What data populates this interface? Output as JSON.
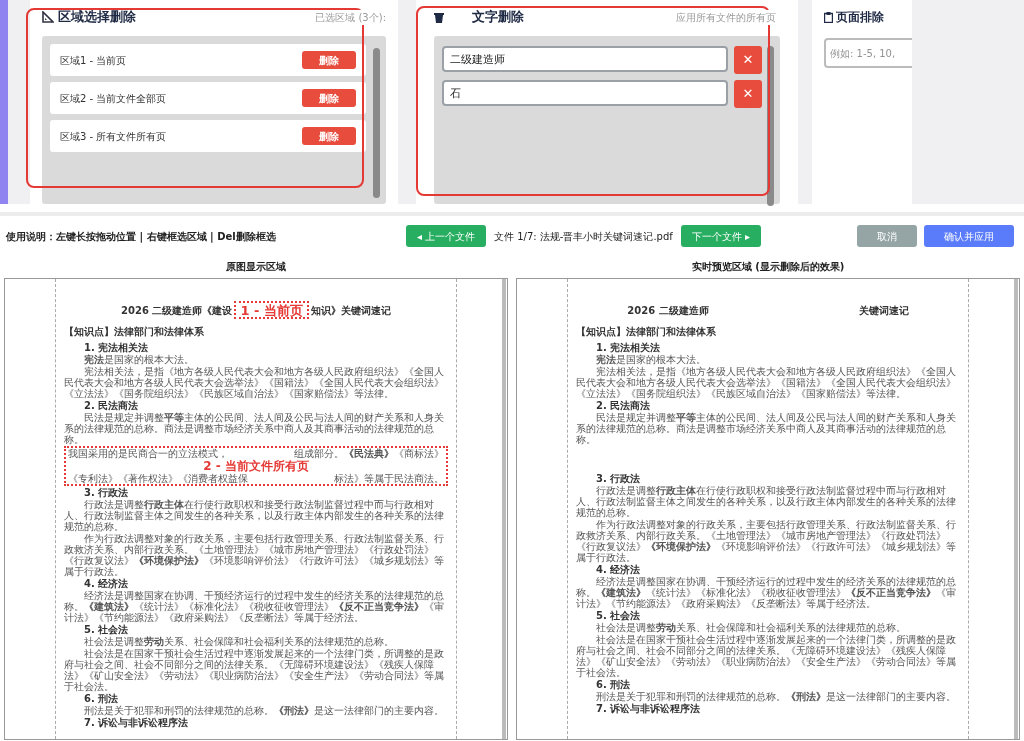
{
  "region_panel": {
    "title": "区域选择删除",
    "summary": "已选区域 (3个):",
    "regions": [
      {
        "label": "区域1 - 当前页",
        "button": "删除"
      },
      {
        "label": "区域2 - 当前文件全部页",
        "button": "删除"
      },
      {
        "label": "区域3 - 所有文件所有页",
        "button": "删除"
      }
    ]
  },
  "text_panel": {
    "title": "文字删除",
    "scope": "应用所有文件的所有页",
    "terms": [
      {
        "value": "二级建造师",
        "remove": "✕"
      },
      {
        "value": "石",
        "remove": "✕"
      }
    ]
  },
  "page_panel": {
    "title": "页面排除",
    "placeholder": "例如: 1-5, 10,"
  },
  "toolbar": {
    "instructions": "使用说明：左键长按拖动位置 | 右键框选区域 | Del删除框选",
    "prev_button": "◂ 上一个文件",
    "file_label": "文件 1/7: 法规-晋丰小时关键词速记.pdf",
    "next_button": "下一个文件 ▸",
    "cancel_button": "取消",
    "apply_button": "确认并应用"
  },
  "views": [
    {
      "title": "原图显示区域",
      "blocks": [
        {
          "kind": "title",
          "left": "2026 二级建造师《建设",
          "region": "1 - 当前页",
          "right": "知识》关键词速记"
        },
        {
          "kind": "heading",
          "text": "【知识点】法律部门和法律体系"
        },
        {
          "kind": "sub",
          "text": "1. 宪法相关法"
        },
        {
          "kind": "para",
          "text": "**宪法**是国家的根本大法。"
        },
        {
          "kind": "para",
          "text": "宪法相关法，是指《地方各级人民代表大会和地方各级人民政府组织法》《全国人民代表大会和地方各级人民代表大会选举法》《国籍法》《全国人民代表大会组织法》《立法法》《国务院组织法》《民族区域自治法》《国家赔偿法》等法律。"
        },
        {
          "kind": "sub",
          "text": "2. 民法商法"
        },
        {
          "kind": "para",
          "text": "民法是规定并调整**平等**主体的公民间、法人间及公民与法人间的财产关系和人身关系的法律规范的总称。商法是调整市场经济关系中商人及其商事活动的法律规范的总称。"
        },
        {
          "kind": "region",
          "label": "2 - 当前文件所有页",
          "left": [
            "我国采用的是民商合一的立法模式，",
            "《专利法》《著作权法》《消费者权益保"
          ],
          "right": [
            "组成部分。**《民法典》**《商标法》",
            "标法》等属于民法商法。"
          ]
        },
        {
          "kind": "sub",
          "text": "3. 行政法"
        },
        {
          "kind": "para",
          "text": "行政法是调整**行政主体**在行使行政职权和接受行政法制监督过程中而与行政相对人、行政法制监督主体之间发生的各种关系，以及行政主体内部发生的各种关系的法律规范的总称。"
        },
        {
          "kind": "para",
          "text": "作为行政法调整对象的行政关系，主要包括行政管理关系、行政法制监督关系、行政救济关系、内部行政关系。《土地管理法》《城市房地产管理法》《行政处罚法》《行政复议法》**《环境保护法》**《环境影响评价法》《行政许可法》《城乡规划法》等属于行政法。"
        },
        {
          "kind": "sub",
          "text": "4. 经济法"
        },
        {
          "kind": "para",
          "text": "经济法是调整国家在协调、干预经济运行的过程中发生的经济关系的法律规范的总称。**《建筑法》**《统计法》《标准化法》《税收征收管理法》**《反不正当竞争法》**《审计法》《节约能源法》《政府采购法》《反垄断法》等属于经济法。"
        },
        {
          "kind": "sub",
          "text": "5. 社会法"
        },
        {
          "kind": "para",
          "text": "社会法是调整**劳动**关系、社会保障和社会福利关系的法律规范的总称。"
        },
        {
          "kind": "para",
          "text": "社会法是在国家干预社会生活过程中逐渐发展起来的一个法律门类，所调整的是政府与社会之间、社会不同部分之间的法律关系。《无障碍环境建设法》《残疾人保障法》《矿山安全法》《劳动法》《职业病防治法》《安全生产法》《劳动合同法》等属于社会法。"
        },
        {
          "kind": "sub",
          "text": "6. 刑法"
        },
        {
          "kind": "para",
          "text": "刑法是关于犯罪和刑罚的法律规范的总称。**《刑法》**是这一法律部门的主要内容。"
        },
        {
          "kind": "sub",
          "text": "7. 诉讼与非诉讼程序法"
        }
      ]
    },
    {
      "title": "实时预览区域 (显示删除后的效果)",
      "blocks": [
        {
          "kind": "title",
          "left": "2026 二级建造师",
          "right": "关键词速记"
        },
        {
          "kind": "heading",
          "text": "【知识点】法律部门和法律体系"
        },
        {
          "kind": "sub",
          "text": "1. 宪法相关法"
        },
        {
          "kind": "para",
          "text": "**宪法**是国家的根本大法。"
        },
        {
          "kind": "para",
          "text": "宪法相关法，是指《地方各级人民代表大会和地方各级人民政府组织法》《全国人民代表大会和地方各级人民代表大会选举法》《国籍法》《全国人民代表大会组织法》《立法法》《国务院组织法》《民族区域自治法》《国家赔偿法》等法律。"
        },
        {
          "kind": "sub",
          "text": "2. 民法商法"
        },
        {
          "kind": "para",
          "text": "民法是规定并调整**平等**主体的公民间、法人间及公民与法人间的财产关系和人身关系的法律规范的总称。商法是调整市场经济关系中商人及其商事活动的法律规范的总称。"
        },
        {
          "kind": "gap"
        },
        {
          "kind": "sub",
          "text": "3. 行政法"
        },
        {
          "kind": "para",
          "text": "行政法是调整**行政主体**在行使行政职权和接受行政法制监督过程中而与行政相对人、行政法制监督主体之间发生的各种关系，以及行政主体内部发生的各种关系的法律规范的总称。"
        },
        {
          "kind": "para",
          "text": "作为行政法调整对象的行政关系，主要包括行政管理关系、行政法制监督关系、行政救济关系、内部行政关系。《土地管理法》《城市房地产管理法》《行政处罚法》《行政复议法》**《环境保护法》**《环境影响评价法》《行政许可法》《城乡规划法》等属于行政法。"
        },
        {
          "kind": "sub",
          "text": "4. 经济法"
        },
        {
          "kind": "para",
          "text": "经济法是调整国家在协调、干预经济运行的过程中发生的经济关系的法律规范的总称。**《建筑法》**《统计法》《标准化法》《税收征收管理法》**《反不正当竞争法》**《审计法》《节约能源法》《政府采购法》《反垄断法》等属于经济法。"
        },
        {
          "kind": "sub",
          "text": "5. 社会法"
        },
        {
          "kind": "para",
          "text": "社会法是调整**劳动**关系、社会保障和社会福利关系的法律规范的总称。"
        },
        {
          "kind": "para",
          "text": "社会法是在国家干预社会生活过程中逐渐发展起来的一个法律门类，所调整的是政府与社会之间、社会不同部分之间的法律关系。《无障碍环境建设法》《残疾人保障法》《矿山安全法》《劳动法》《职业病防治法》《安全生产法》《劳动合同法》等属于社会法。"
        },
        {
          "kind": "sub",
          "text": "6. 刑法"
        },
        {
          "kind": "para",
          "text": "刑法是关于犯罪和刑罚的法律规范的总称。**《刑法》**是这一法律部门的主要内容。"
        },
        {
          "kind": "sub",
          "text": "7. 诉讼与非诉讼程序法"
        }
      ]
    }
  ]
}
